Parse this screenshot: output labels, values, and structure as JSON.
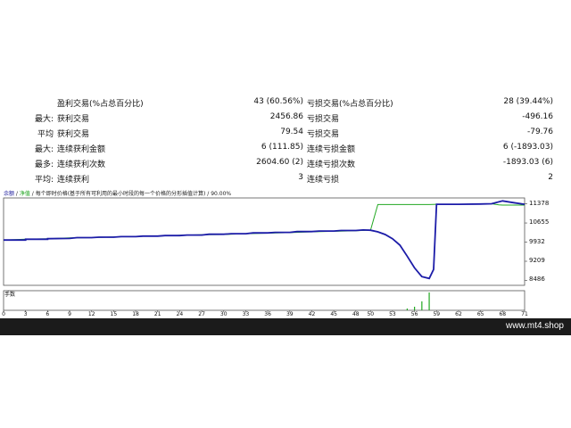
{
  "colors": {
    "balance": "#1c1ca8",
    "equity": "#22a822",
    "volume": "#22a822",
    "footer": "#1b1b1b"
  },
  "stats": [
    {
      "label1": "",
      "label2": "盈利交易(%占总百分比)",
      "value1": "43 (60.56%)",
      "label3": "亏损交易(%占总百分比)",
      "value2": "28 (39.44%)"
    },
    {
      "label1": "最大:",
      "label2": "获利交易",
      "value1": "2456.86",
      "label3": "亏损交易",
      "value2": "-496.16"
    },
    {
      "label1": "平均",
      "label2": "获利交易",
      "value1": "79.54",
      "label3": "亏损交易",
      "value2": "-79.76"
    },
    {
      "label1": "最大:",
      "label2": "连续获利金额",
      "value1": "6 (111.85)",
      "label3": "连续亏损金额",
      "value2": "6 (-1893.03)"
    },
    {
      "label1": "最多:",
      "label2": "连续获利次数",
      "value1": "2604.60 (2)",
      "label3": "连续亏损次数",
      "value2": "-1893.03 (6)"
    },
    {
      "label1": "平均:",
      "label2": "连续获利",
      "value1": "3",
      "label3": "连续亏损",
      "value2": "2"
    }
  ],
  "chart_legend": {
    "balance": "余额",
    "sep1": " / ",
    "equity": "净值",
    "sep2": " / ",
    "text": "每个即时价格(基于所有可利用的最小时段的每一个价格的分形插值计算) / 90.00%"
  },
  "lots_label": "手数",
  "chart_data": {
    "type": "line",
    "x_ticks": [
      "0",
      "3",
      "6",
      "9",
      "12",
      "15",
      "18",
      "21",
      "24",
      "27",
      "30",
      "33",
      "36",
      "39",
      "42",
      "45",
      "48",
      "50",
      "53",
      "56",
      "59",
      "62",
      "65",
      "68",
      "71"
    ],
    "y_ticks": [
      "11378",
      "10655",
      "9932",
      "9209",
      "8486"
    ],
    "ylim": [
      8300,
      11600
    ],
    "xlim": [
      0,
      71
    ],
    "series": [
      {
        "key": "balance",
        "x": [
          0,
          3,
          3,
          6,
          6,
          9,
          10,
          12,
          13,
          15,
          16,
          18,
          19,
          21,
          22,
          24,
          25,
          27,
          28,
          30,
          31,
          33,
          34,
          36,
          37,
          39,
          40,
          42,
          43,
          45,
          46,
          48,
          49,
          50,
          51,
          52,
          53,
          54,
          55,
          56,
          57,
          58,
          58.6,
          59,
          62,
          65,
          66.5,
          68,
          69.5,
          71
        ],
        "y": [
          10010,
          10010,
          10040,
          10040,
          10060,
          10070,
          10100,
          10100,
          10120,
          10120,
          10140,
          10140,
          10160,
          10160,
          10180,
          10180,
          10200,
          10200,
          10230,
          10230,
          10250,
          10250,
          10280,
          10280,
          10300,
          10300,
          10330,
          10330,
          10350,
          10350,
          10370,
          10370,
          10390,
          10380,
          10320,
          10220,
          10060,
          9820,
          9400,
          8960,
          8630,
          8560,
          8900,
          11360,
          11360,
          11370,
          11380,
          11490,
          11420,
          11360
        ]
      },
      {
        "key": "equity",
        "x": [
          0,
          3,
          6,
          9,
          12,
          15,
          18,
          21,
          24,
          27,
          30,
          33,
          36,
          39,
          42,
          45,
          48,
          50,
          51,
          53,
          56,
          58,
          59,
          62,
          65,
          66.5,
          67.5,
          68,
          69.5,
          71
        ],
        "y": [
          10010,
          10040,
          10060,
          10090,
          10100,
          10130,
          10150,
          10160,
          10190,
          10210,
          10220,
          10250,
          10270,
          10290,
          10320,
          10340,
          10360,
          10380,
          11350,
          11350,
          11350,
          11350,
          11360,
          11360,
          11370,
          11380,
          11340,
          11330,
          11330,
          11330
        ]
      }
    ],
    "volume": {
      "x": [
        55,
        56,
        57,
        58
      ],
      "lots": [
        0.1,
        0.2,
        0.5,
        1.0
      ]
    }
  },
  "watermark": "www.mt4.shop"
}
